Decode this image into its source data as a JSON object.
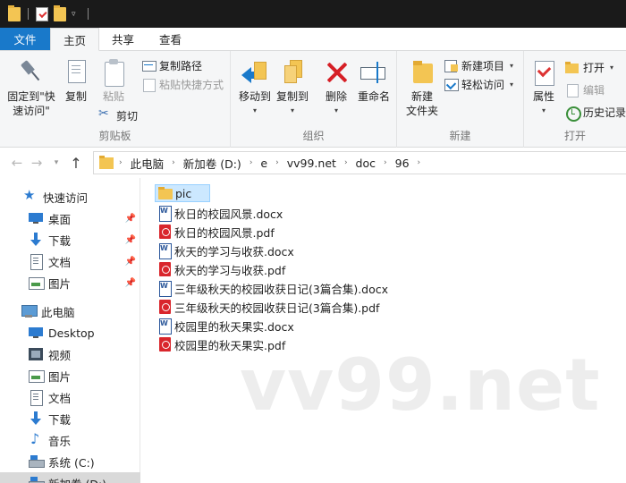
{
  "ribbon_tabs": [
    {
      "label": "文件"
    },
    {
      "label": "主页"
    },
    {
      "label": "共享"
    },
    {
      "label": "查看"
    }
  ],
  "ribbon": {
    "clipboard": {
      "pin_label_1": "固定到\"快",
      "pin_label_2": "速访问\"",
      "copy": "复制",
      "paste": "粘贴",
      "copy_path": "复制路径",
      "paste_shortcut": "粘贴快捷方式",
      "cut": "剪切",
      "group_label": "剪贴板"
    },
    "organize": {
      "move_to": "移动到",
      "copy_to": "复制到",
      "delete": "删除",
      "rename": "重命名",
      "group_label": "组织"
    },
    "new": {
      "new_folder_1": "新建",
      "new_folder_2": "文件夹",
      "new_item": "新建项目",
      "easy_access": "轻松访问",
      "group_label": "新建"
    },
    "open": {
      "properties": "属性",
      "open": "打开",
      "edit": "编辑",
      "history": "历史记录",
      "group_label": "打开"
    }
  },
  "address": {
    "crumbs": [
      "此电脑",
      "新加卷 (D:)",
      "e",
      "vv99.net",
      "doc",
      "96"
    ]
  },
  "sidebar": {
    "items": [
      {
        "label": "快速访问",
        "icon": "star-icon"
      },
      {
        "label": "桌面",
        "icon": "desktop-icon"
      },
      {
        "label": "下载",
        "icon": "download-icon"
      },
      {
        "label": "文档",
        "icon": "document-icon"
      },
      {
        "label": "图片",
        "icon": "picture-icon"
      },
      {
        "label": "此电脑",
        "icon": "computer-icon"
      },
      {
        "label": "Desktop",
        "icon": "desktop-icon"
      },
      {
        "label": "视频",
        "icon": "video-icon"
      },
      {
        "label": "图片",
        "icon": "picture-icon"
      },
      {
        "label": "文档",
        "icon": "document-icon"
      },
      {
        "label": "下载",
        "icon": "download-icon"
      },
      {
        "label": "音乐",
        "icon": "music-icon"
      },
      {
        "label": "系统 (C:)",
        "icon": "drive-icon"
      },
      {
        "label": "新加卷 (D:)",
        "icon": "drive-icon"
      }
    ]
  },
  "files": [
    {
      "name": "pic",
      "type": "folder"
    },
    {
      "name": "秋日的校园风景.docx",
      "type": "word"
    },
    {
      "name": "秋日的校园风景.pdf",
      "type": "pdf"
    },
    {
      "name": "秋天的学习与收获.docx",
      "type": "word"
    },
    {
      "name": "秋天的学习与收获.pdf",
      "type": "pdf"
    },
    {
      "name": "三年级秋天的校园收获日记(3篇合集).docx",
      "type": "word"
    },
    {
      "name": "三年级秋天的校园收获日记(3篇合集).pdf",
      "type": "pdf"
    },
    {
      "name": "校园里的秋天果实.docx",
      "type": "word"
    },
    {
      "name": "校园里的秋天果实.pdf",
      "type": "pdf"
    }
  ],
  "watermark": "vv99.net"
}
